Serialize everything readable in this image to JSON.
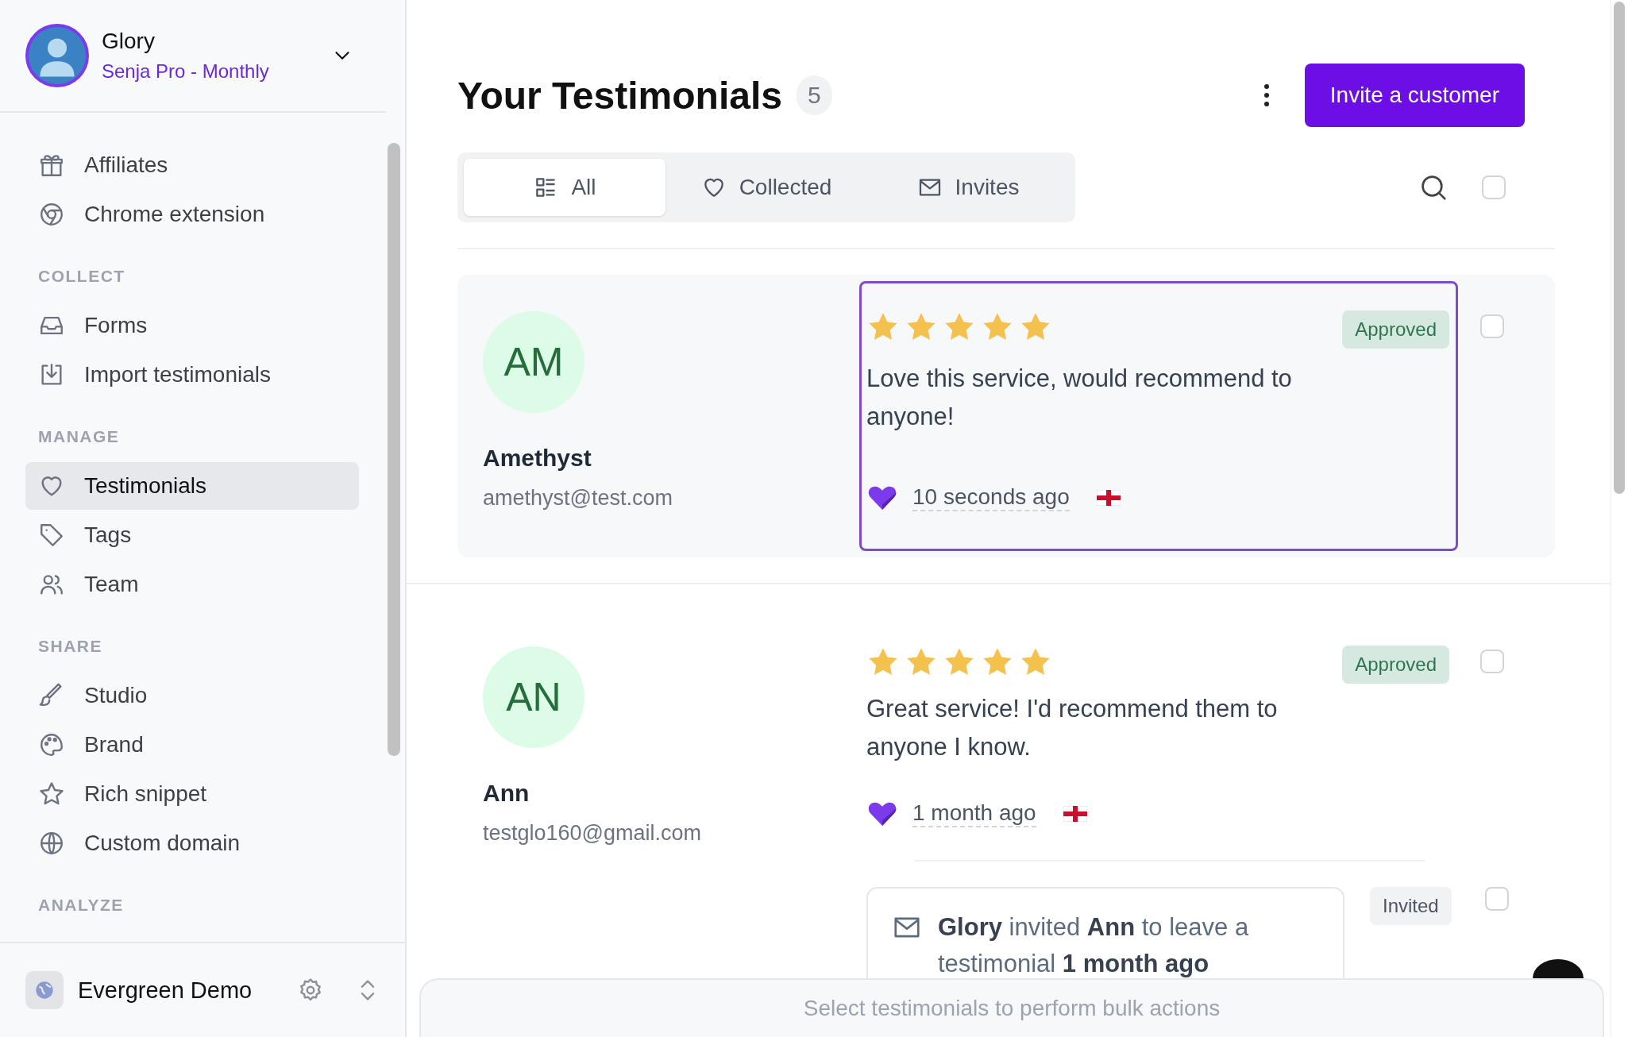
{
  "account": {
    "name": "Glory",
    "plan": "Senja Pro - Monthly"
  },
  "sidebar": {
    "sections": [
      {
        "items": [
          {
            "label": "Affiliates",
            "kind": "gift",
            "selected": false
          },
          {
            "label": "Chrome extension",
            "kind": "chrome",
            "selected": false
          }
        ]
      },
      {
        "heading": "COLLECT",
        "items": [
          {
            "label": "Forms",
            "kind": "inbox",
            "selected": false
          },
          {
            "label": "Import testimonials",
            "kind": "import",
            "selected": false
          }
        ]
      },
      {
        "heading": "MANAGE",
        "items": [
          {
            "label": "Testimonials",
            "kind": "heart",
            "selected": true
          },
          {
            "label": "Tags",
            "kind": "tag",
            "selected": false
          },
          {
            "label": "Team",
            "kind": "users",
            "selected": false
          }
        ]
      },
      {
        "heading": "SHARE",
        "items": [
          {
            "label": "Studio",
            "kind": "brush",
            "selected": false
          },
          {
            "label": "Brand",
            "kind": "palette",
            "selected": false
          },
          {
            "label": "Rich snippet",
            "kind": "star",
            "selected": false
          },
          {
            "label": "Custom domain",
            "kind": "globe",
            "selected": false
          }
        ]
      },
      {
        "heading": "ANALYZE"
      }
    ]
  },
  "workspace": {
    "name": "Evergreen Demo"
  },
  "page": {
    "title": "Your Testimonials",
    "count": "5",
    "primary_button": "Invite a customer"
  },
  "tabs": [
    {
      "label": "All",
      "kind": "grid",
      "selected": true
    },
    {
      "label": "Collected",
      "kind": "heart",
      "selected": false
    },
    {
      "label": "Invites",
      "kind": "mail",
      "selected": false
    }
  ],
  "select_all": {
    "checked": false
  },
  "testimonials": [
    {
      "initials": "AM",
      "name": "Amethyst",
      "email": "amethyst@test.com",
      "stars": 5,
      "text": "Love this service, would recommend to anyone!",
      "time": "10 seconds ago",
      "status": {
        "label": "Approved",
        "kind": "approved"
      },
      "highlighted": true,
      "carded": true,
      "checked": false
    },
    {
      "initials": "AN",
      "name": "Ann",
      "email": "testglo160@gmail.com",
      "stars": 5,
      "text": "Great service! I'd recommend them to anyone I know.",
      "time": "1 month ago",
      "status": {
        "label": "Approved",
        "kind": "approved"
      },
      "highlighted": false,
      "carded": false,
      "checked": false,
      "invite": {
        "text": "**Glory** invited **Ann** to leave a testimonial **1 month ago**",
        "status": {
          "label": "Invited",
          "kind": "invited"
        },
        "checked": false
      }
    }
  ],
  "bulk_bar": {
    "text": "Select testimonials to perform bulk actions"
  }
}
